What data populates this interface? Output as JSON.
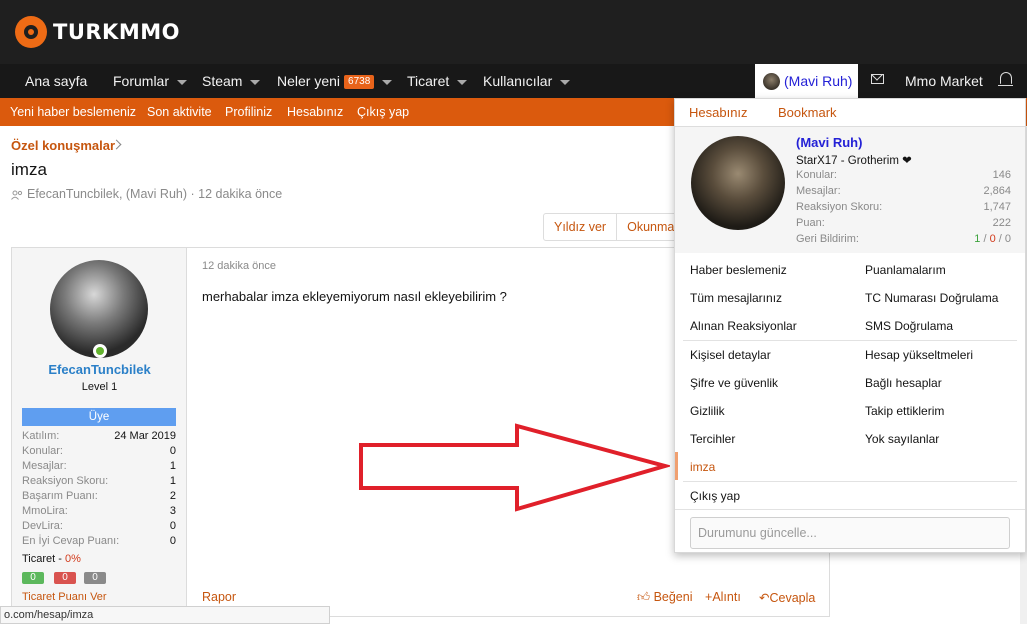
{
  "header": {
    "logo_text": "TURKMMO"
  },
  "nav": {
    "items": [
      {
        "label": "Ana sayfa",
        "caret": false
      },
      {
        "label": "Forumlar",
        "caret": true
      },
      {
        "label": "Steam",
        "caret": true
      },
      {
        "label": "Neler yeni",
        "caret": false,
        "badge": "6738"
      },
      {
        "label": "Ticaret",
        "caret": true
      },
      {
        "label": "Kullanıcılar",
        "caret": true
      }
    ],
    "user": "(Mavi Ruh)",
    "market": "Mmo Market"
  },
  "subnav": [
    "Yeni haber beslemeniz",
    "Son aktivite",
    "Profiliniz",
    "Hesabınız",
    "Çıkış yap"
  ],
  "breadcrumb": "Özel konuşmalar",
  "thread": {
    "title": "imza",
    "meta": "EfecanTuncbilek, (Mavi Ruh) · 12 dakika önce",
    "buttons": [
      "Yıldız ver",
      "Okunmad"
    ]
  },
  "post": {
    "time": "12 dakika önce",
    "body": "merhabalar imza ekleyemiyorum nasıl ekleyebilirim ?",
    "footer": {
      "report": "Rapor",
      "like": "Beğeni",
      "quote": "Alıntı",
      "reply": "Cevapla"
    },
    "user": {
      "name": "EfecanTuncbilek",
      "level": "Level 1",
      "role": "Üye",
      "stats": [
        {
          "k": "Katılım:",
          "v": "24 Mar 2019"
        },
        {
          "k": "Konular:",
          "v": "0"
        },
        {
          "k": "Mesajlar:",
          "v": "1"
        },
        {
          "k": "Reaksiyon Skoru:",
          "v": "1"
        },
        {
          "k": "Başarım Puanı:",
          "v": "2"
        },
        {
          "k": "MmoLira:",
          "v": "3"
        },
        {
          "k": "DevLira:",
          "v": "0"
        },
        {
          "k": "En İyi Cevap Puanı:",
          "v": "0"
        }
      ],
      "trade_label": "Ticaret - ",
      "trade_pct": "0%",
      "trade_boxes": [
        "0",
        "0",
        "0"
      ],
      "trade_link": "Ticaret Puanı Ver"
    }
  },
  "status_url": "o.com/hesap/imza",
  "dropdown": {
    "tabs": [
      "Hesabınız",
      "Bookmark"
    ],
    "name": "(Mavi Ruh)",
    "title": "StarX17 - Grotherim ❤",
    "stats": [
      {
        "k": "Konular:",
        "v": "146"
      },
      {
        "k": "Mesajlar:",
        "v": "2,864"
      },
      {
        "k": "Reaksiyon Skoru:",
        "v": "1,747"
      },
      {
        "k": "Puan:",
        "v": "222"
      }
    ],
    "feedback_label": "Geri Bildirim:",
    "feedback": {
      "pos": "1",
      "neu": "0",
      "neg": "0",
      "sep": " / "
    },
    "links_left": [
      "Haber beslemeniz",
      "Tüm mesajlarınız",
      "Alınan Reaksiyonlar"
    ],
    "links_right": [
      "Puanlamalarım",
      "TC Numarası Doğrulama",
      "SMS Doğrulama"
    ],
    "links2_left": [
      "Kişisel detaylar",
      "Şifre ve güvenlik",
      "Gizlilik",
      "Tercihler",
      "imza"
    ],
    "links2_right": [
      "Hesap yükseltmeleri",
      "Bağlı hesaplar",
      "Takip ettiklerim",
      "Yok sayılanlar"
    ],
    "logout": "Çıkış yap",
    "status_placeholder": "Durumunu güncelle..."
  },
  "colors": {
    "accent": "#db5a0d",
    "link": "#c6560f",
    "username": "#2421d6",
    "role": "#5f9ef0",
    "arrow": "#e0202a"
  }
}
